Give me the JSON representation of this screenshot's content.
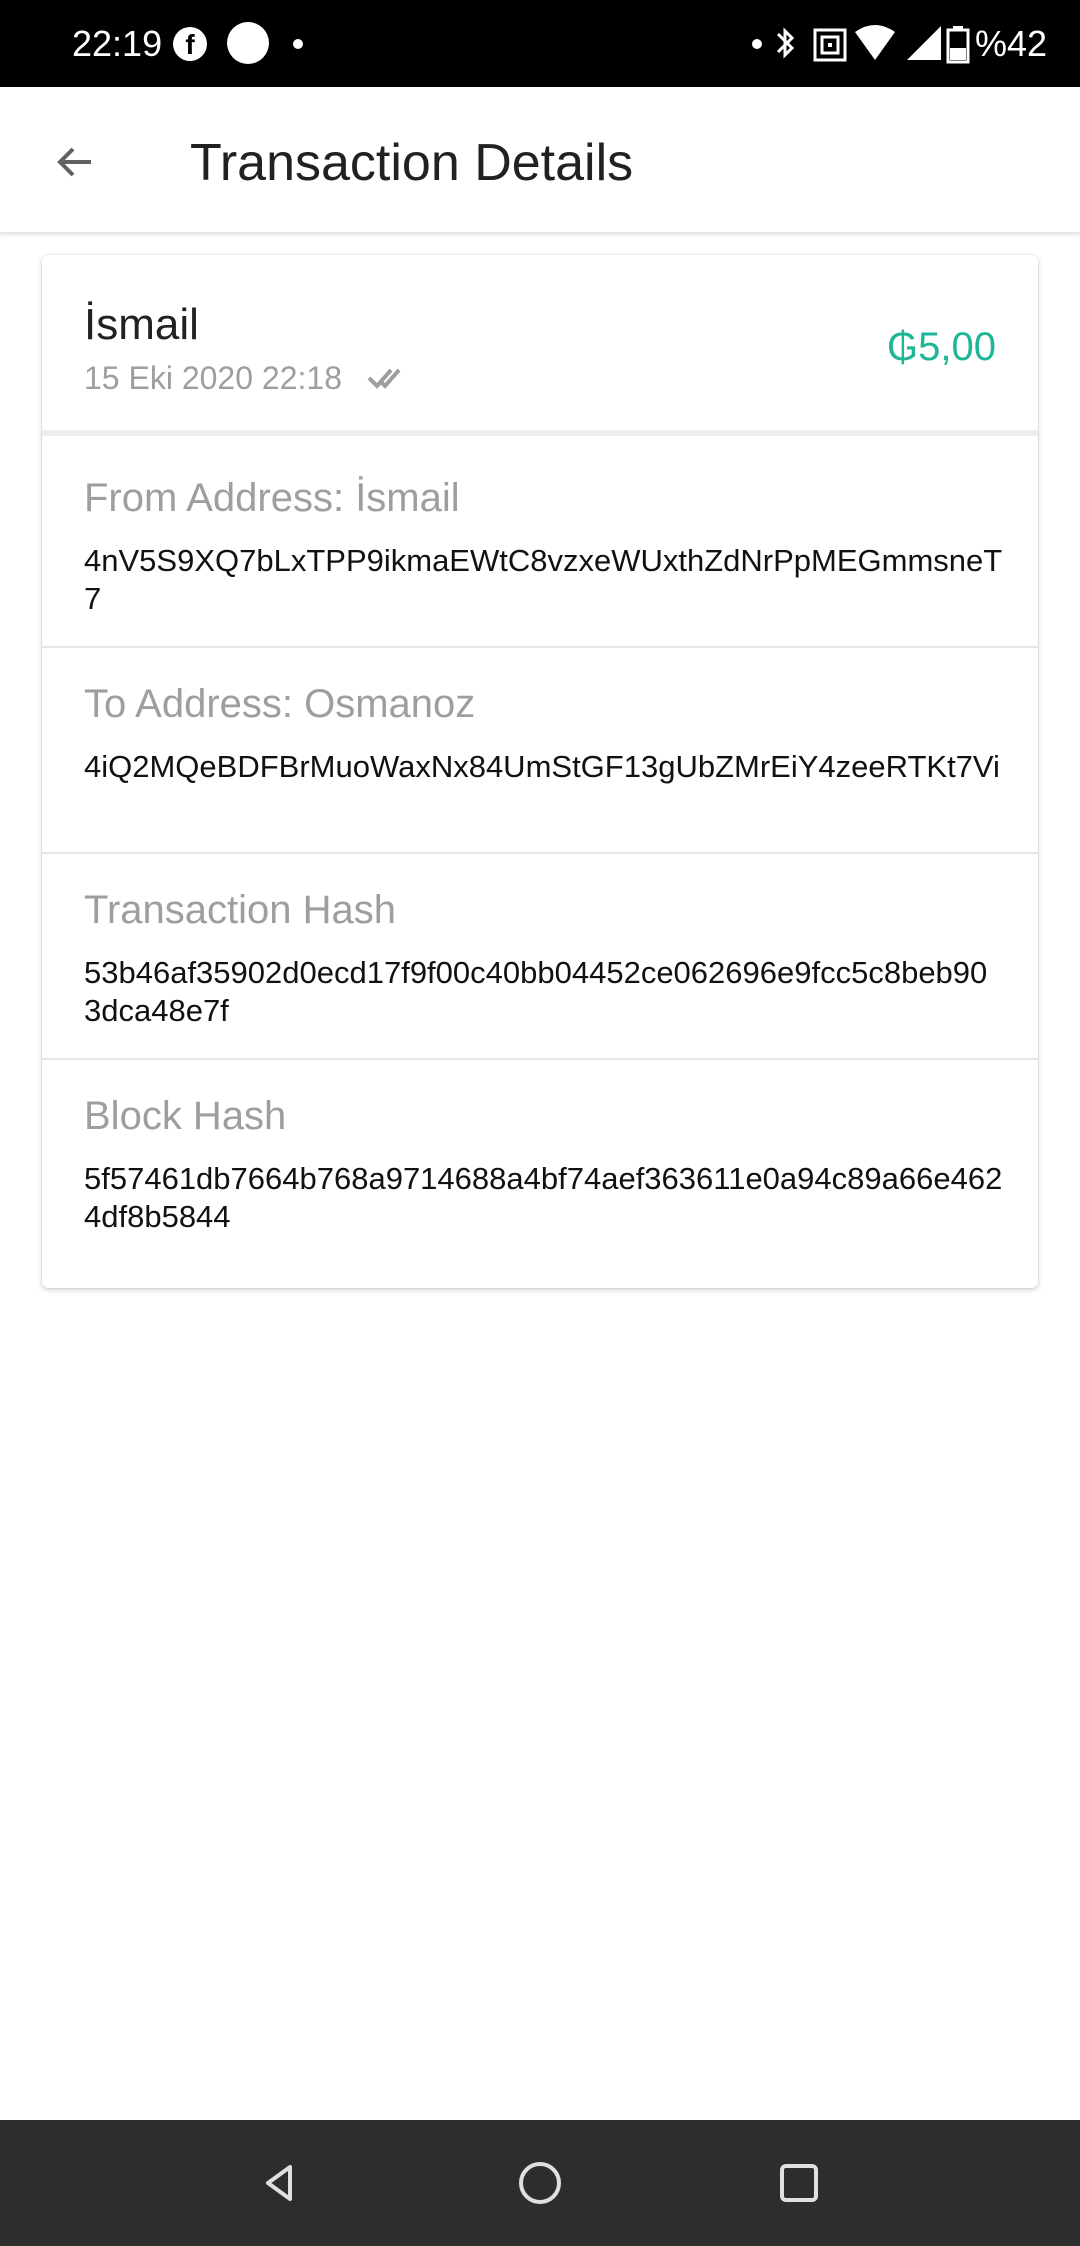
{
  "status_bar": {
    "time": "22:19",
    "battery_text": "%42",
    "icons": [
      "facebook-icon",
      "circle-notification-icon",
      "dot-icon",
      "bluetooth-icon",
      "nfc-icon",
      "wifi-icon",
      "signal-icon",
      "battery-icon"
    ]
  },
  "header": {
    "title": "Transaction Details",
    "back_icon": "arrow-left-icon"
  },
  "transaction": {
    "counterparty": "İsmail",
    "date": "15 Eki 2020 22:18",
    "status_icon": "double-check-icon",
    "amount": "₲5,00",
    "amount_color": "#1fb597"
  },
  "details": [
    {
      "label": "From Address: İsmail",
      "value": "4nV5S9XQ7bLxTPP9ikmaEWtC8vzxeWUxthZdNrPpMEGmmsneT7"
    },
    {
      "label": "To Address: Osmanoz",
      "value": "4iQ2MQeBDFBrMuoWaxNx84UmStGF13gUbZMrEiY4zeeRTKt7Vi"
    },
    {
      "label": "Transaction Hash",
      "value": "53b46af35902d0ecd17f9f00c40bb04452ce062696e9fcc5c8beb903dca48e7f"
    },
    {
      "label": "Block Hash",
      "value": "5f57461db7664b768a9714688a4bf74aef363611e0a94c89a66e4624df8b5844"
    }
  ],
  "nav_bar": {
    "icons": [
      "back-triangle-icon",
      "home-circle-icon",
      "recents-square-icon"
    ]
  }
}
